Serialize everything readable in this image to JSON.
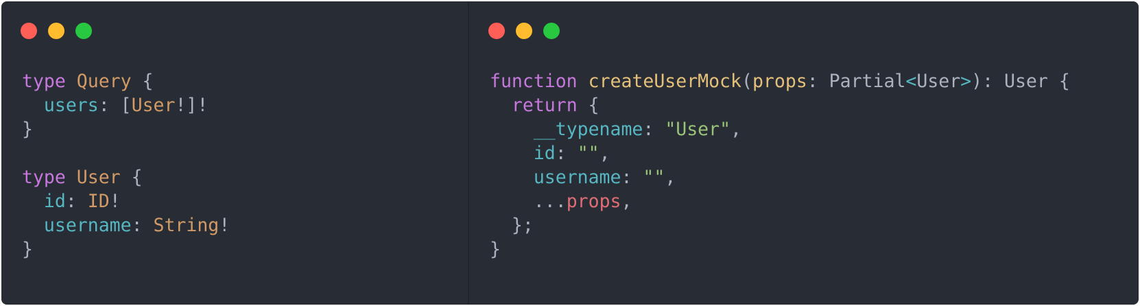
{
  "window_controls": {
    "colors": {
      "close": "#ff5f57",
      "minimize": "#febc2e",
      "maximize": "#28c840"
    }
  },
  "theme": {
    "background": "#282c34",
    "keyword": "#c678dd",
    "type": "#d19a66",
    "field": "#56b6c2",
    "function": "#e5c07b",
    "string": "#98c379",
    "variable": "#e06c75",
    "punctuation": "#abb2bf"
  },
  "left_code": {
    "l1": {
      "kw": "type",
      "name": "Query",
      "brace": "{"
    },
    "l2": {
      "field": "users",
      "colon": ":",
      "open": "[",
      "type": "User",
      "tail": "!]!"
    },
    "l3": {
      "brace": "}"
    },
    "l5": {
      "kw": "type",
      "name": "User",
      "brace": "{"
    },
    "l6": {
      "field": "id",
      "colon": ":",
      "type": "ID",
      "bang": "!"
    },
    "l7": {
      "field": "username",
      "colon": ":",
      "type": "String",
      "bang": "!"
    },
    "l8": {
      "brace": "}"
    }
  },
  "right_code": {
    "l1": {
      "kw": "function",
      "fn": "createUserMock",
      "open": "(",
      "param": "props",
      "colon": ":",
      "partial": "Partial",
      "lt": "<",
      "generic": "User",
      "gt": ">",
      "close": "):",
      "ret": "User",
      "brace": "{"
    },
    "l2": {
      "kw": "return",
      "brace": "{"
    },
    "l3": {
      "field": "__typename",
      "colon": ":",
      "str": "\"User\"",
      "comma": ","
    },
    "l4": {
      "field": "id",
      "colon": ":",
      "str": "\"\"",
      "comma": ","
    },
    "l5": {
      "field": "username",
      "colon": ":",
      "str": "\"\"",
      "comma": ","
    },
    "l6": {
      "spread": "...",
      "var": "props",
      "comma": ","
    },
    "l7": {
      "close": "};"
    },
    "l8": {
      "brace": "}"
    }
  }
}
